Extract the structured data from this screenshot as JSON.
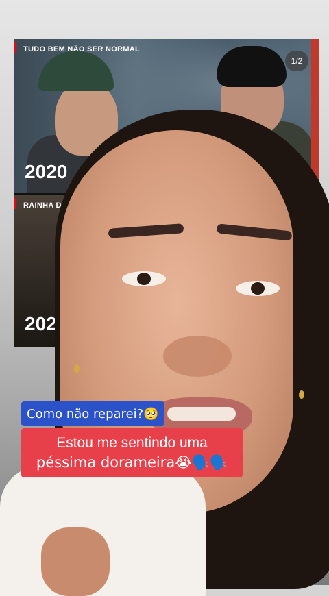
{
  "screenshot": {
    "pager": "1/2",
    "cards": [
      {
        "title": "TUDO BEM NÃO SER NORMAL",
        "year": "2020"
      },
      {
        "title": "RAINHA DAS",
        "year": "202"
      }
    ]
  },
  "captions": {
    "line1": "Como não reparei?🥺",
    "line2_a": "Estou me sentindo uma",
    "line2_b": "péssima dorameira😭🗣️🗣️"
  },
  "colors": {
    "caption_blue": "#2b52c9",
    "caption_red": "#e8404a",
    "netflix_red": "#e50914"
  }
}
